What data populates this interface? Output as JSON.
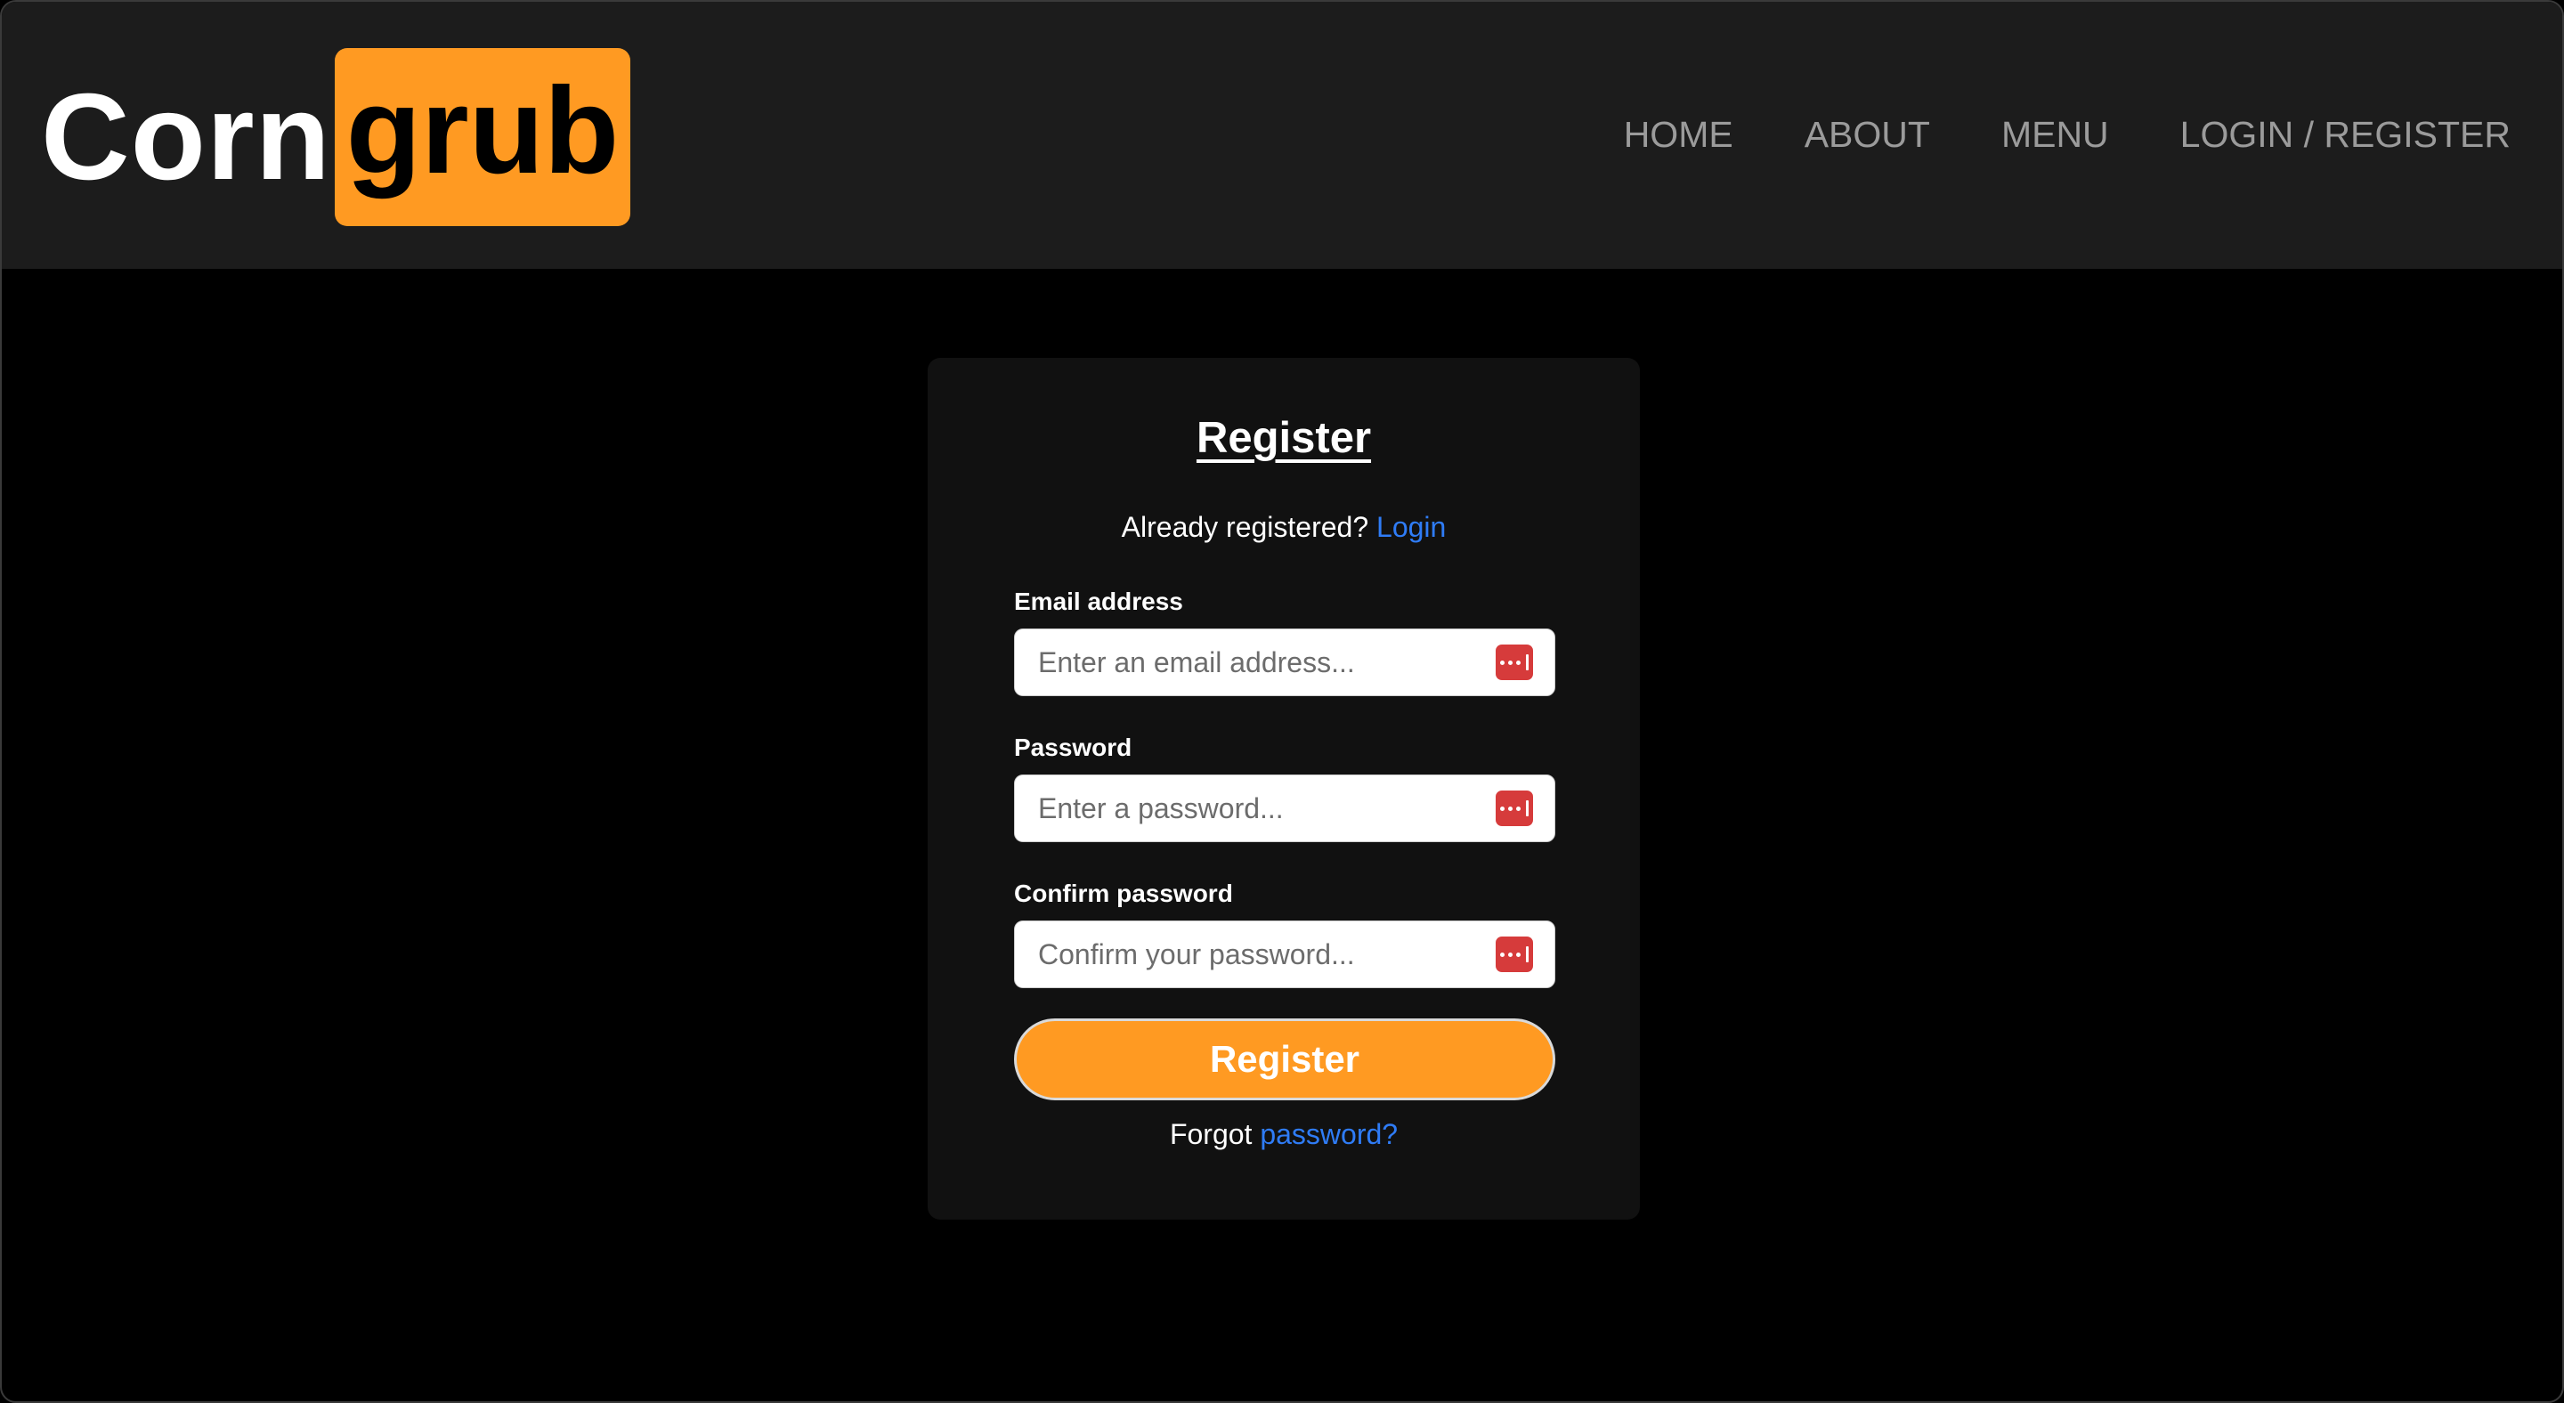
{
  "header": {
    "logo_left": "Corn",
    "logo_right": "grub",
    "nav": {
      "home": "HOME",
      "about": "ABOUT",
      "menu": "MENU",
      "login_register": "LOGIN / REGISTER"
    }
  },
  "form": {
    "title": "Register",
    "already_text": "Already registered?",
    "login_link": "Login",
    "email": {
      "label": "Email address",
      "placeholder": "Enter an email address...",
      "value": ""
    },
    "password": {
      "label": "Password",
      "placeholder": "Enter a password...",
      "value": ""
    },
    "confirm": {
      "label": "Confirm password",
      "placeholder": "Confirm your password...",
      "value": ""
    },
    "submit_label": "Register",
    "forgot_text": "Forgot",
    "forgot_link": "password?"
  },
  "colors": {
    "brand": "#ff9a22",
    "link": "#2f7cf6",
    "password_manager_icon": "#d63b3b",
    "navbar_bg": "#1c1c1c",
    "card_bg": "#111111"
  },
  "icons": {
    "password_manager": "password-manager-icon"
  }
}
